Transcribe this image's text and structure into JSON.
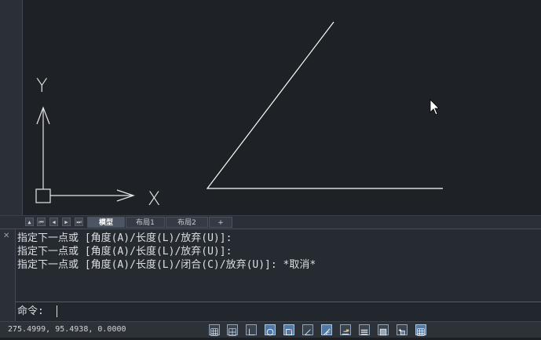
{
  "drawing": {
    "ucs_y_label": "Y",
    "ucs_x_label": "X"
  },
  "tabs": {
    "model": "模型",
    "layout1": "布局1",
    "layout2": "布局2",
    "add": "+"
  },
  "command": {
    "history": [
      "指定下一点或 [角度(A)/长度(L)/放弃(U)]:",
      "指定下一点或 [角度(A)/长度(L)/放弃(U)]:",
      "指定下一点或 [角度(A)/长度(L)/闭合(C)/放弃(U)]: *取消*"
    ],
    "prompt": "命令:"
  },
  "status": {
    "coordinates": "275.4999, 95.4938, 0.0000",
    "toggles": [
      {
        "icon": "grid-display-icon",
        "active": false
      },
      {
        "icon": "snap-grid-icon",
        "active": false
      },
      {
        "icon": "ortho-icon",
        "active": false
      },
      {
        "icon": "polar-tracking-icon",
        "active": true
      },
      {
        "icon": "object-snap-icon",
        "active": true
      },
      {
        "icon": "object-snap-tracking-icon",
        "active": false
      },
      {
        "icon": "dynamic-ucs-icon",
        "active": true
      },
      {
        "icon": "dynamic-input-icon",
        "active": false
      },
      {
        "icon": "lineweight-icon",
        "active": false
      },
      {
        "icon": "transparency-icon",
        "active": false
      },
      {
        "icon": "selection-cycling-icon",
        "active": false
      },
      {
        "icon": "annotation-monitor-icon",
        "active": true
      }
    ]
  },
  "colors": {
    "canvas_bg": "#1e2227",
    "line": "#ffffff",
    "active_toggle": "#4f79a8"
  }
}
